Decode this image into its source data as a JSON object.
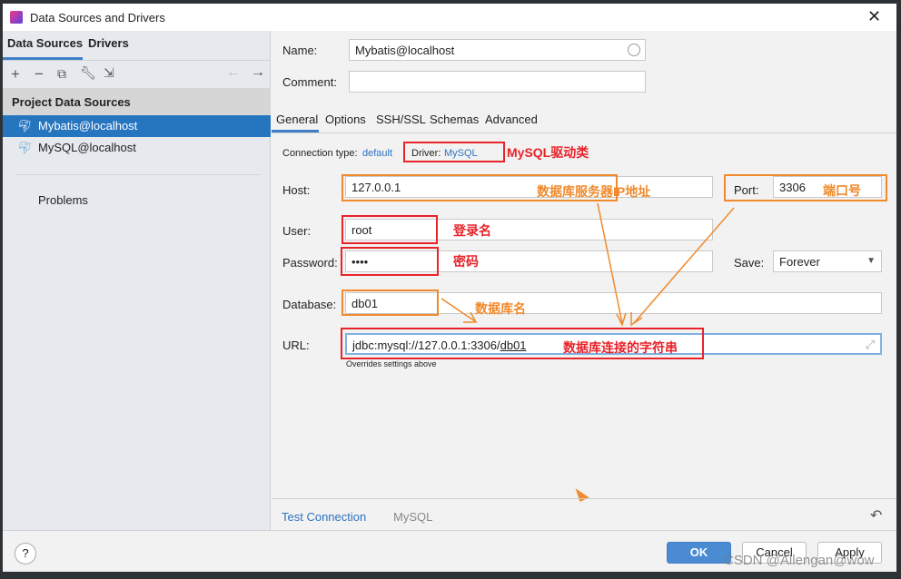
{
  "window": {
    "title": "Data Sources and Drivers"
  },
  "left": {
    "tabs": [
      "Data Sources",
      "Drivers"
    ],
    "section": "Project Data Sources",
    "items": [
      "Mybatis@localhost",
      "MySQL@localhost"
    ],
    "problems": "Problems"
  },
  "form": {
    "name_label": "Name:",
    "name": "Mybatis@localhost",
    "comment_label": "Comment:",
    "comment": "",
    "tabs": [
      "General",
      "Options",
      "SSH/SSL",
      "Schemas",
      "Advanced"
    ],
    "conn_type_label": "Connection type:",
    "conn_type": "default",
    "driver_label": "Driver:",
    "driver": "MySQL",
    "host_label": "Host:",
    "host": "127.0.0.1",
    "port_label": "Port:",
    "port": "3306",
    "user_label": "User:",
    "user": "root",
    "password_label": "Password:",
    "password": "••••",
    "save_label": "Save:",
    "save": "Forever",
    "database_label": "Database:",
    "database": "db01",
    "url_label": "URL:",
    "url_prefix": "jdbc:mysql://127.0.0.1:3306/",
    "url_db": "db01",
    "url_hint": "Overrides settings above"
  },
  "annotations": {
    "driver": "MySQL驱动类",
    "host": "数据库服务器IP地址",
    "port": "端口号",
    "user": "登录名",
    "password": "密码",
    "database": "数据库名",
    "url": "数据库连接的字符串"
  },
  "bottom": {
    "test": "Test Connection",
    "driver": "MySQL",
    "ok": "OK",
    "cancel": "Cancel",
    "apply": "Apply",
    "help": "?"
  },
  "watermark": "CSDN @Allengan@wow",
  "colors": {
    "accent": "#2675bf",
    "annotation_red": "#e8232a",
    "annotation_orange": "#f08a2c"
  }
}
